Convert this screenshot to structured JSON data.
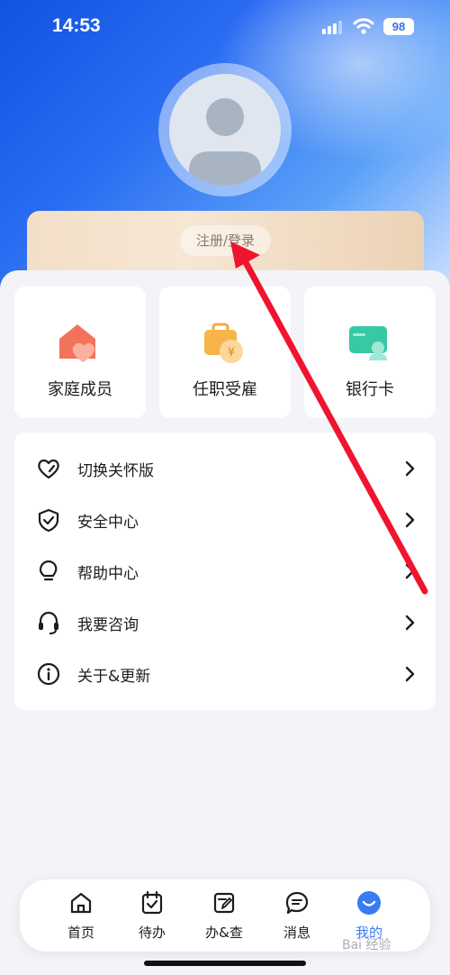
{
  "status_bar": {
    "time": "14:53",
    "battery": "98"
  },
  "login": {
    "label": "注册/登录"
  },
  "quick_actions": [
    {
      "label": "家庭成员",
      "icon": "house-heart-icon"
    },
    {
      "label": "任职受雇",
      "icon": "briefcase-yen-icon"
    },
    {
      "label": "银行卡",
      "icon": "bank-card-icon"
    }
  ],
  "menu": [
    {
      "label": "切换关怀版",
      "icon": "heart-outline-icon"
    },
    {
      "label": "安全中心",
      "icon": "shield-check-icon"
    },
    {
      "label": "帮助中心",
      "icon": "lightbulb-icon"
    },
    {
      "label": "我要咨询",
      "icon": "headset-icon"
    },
    {
      "label": "关于&更新",
      "icon": "info-icon"
    }
  ],
  "tabs": [
    {
      "label": "首页",
      "icon": "home-icon"
    },
    {
      "label": "待办",
      "icon": "calendar-check-icon"
    },
    {
      "label": "办&查",
      "icon": "document-edit-icon"
    },
    {
      "label": "消息",
      "icon": "message-icon"
    },
    {
      "label": "我的",
      "icon": "smile-icon",
      "active": true
    }
  ],
  "colors": {
    "accent": "#3a7bf5",
    "annotation_arrow": "#f0142e"
  },
  "watermark": "Bai 经验"
}
